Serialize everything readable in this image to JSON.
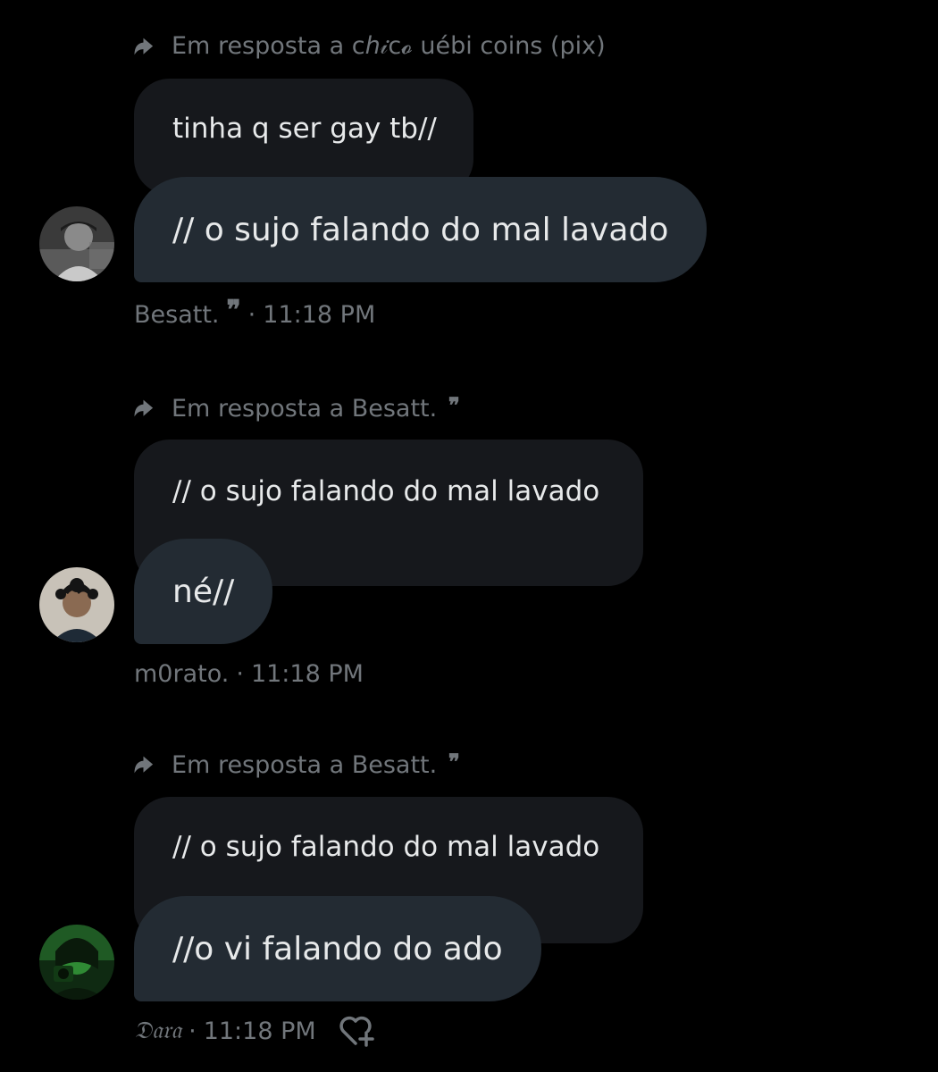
{
  "messages": [
    {
      "reply_prefix": "Em resposta a",
      "reply_target": "cℎ𝒾c𝓸 uébi coins (pix)",
      "reply_target_has_quote_glyph": false,
      "quoted_text": "tinha q ser gay tb//",
      "text": "// o sujo falando do mal lavado",
      "sender": "Besatt.",
      "sender_has_quote_glyph": true,
      "separator": "·",
      "time": "11:18 PM",
      "avatar_icon": "avatar-photo-grayscale"
    },
    {
      "reply_prefix": "Em resposta a",
      "reply_target": "Besatt.",
      "reply_target_has_quote_glyph": true,
      "quoted_text": "// o sujo falando do mal lavado",
      "text": "né//",
      "sender": "m0rato.",
      "sender_has_quote_glyph": false,
      "separator": "·",
      "time": "11:18 PM",
      "avatar_icon": "avatar-photo-curly-hair"
    },
    {
      "reply_prefix": "Em resposta a",
      "reply_target": "Besatt.",
      "reply_target_has_quote_glyph": true,
      "quoted_text": "// o sujo falando do mal lavado",
      "text": "//o vi falando do ado",
      "sender": "𝔇𝔞𝔯𝔞",
      "sender_has_quote_glyph": false,
      "separator": "·",
      "time": "11:18 PM",
      "avatar_icon": "avatar-photo-green",
      "reaction_icon": "add-reaction-heart-icon"
    }
  ],
  "glyphs": {
    "quote": "❞"
  },
  "colors": {
    "background": "#000000",
    "bubble": "#232b33",
    "quoted_bubble": "#16181c",
    "muted_text": "#71767b",
    "text": "#e7e9ea"
  }
}
